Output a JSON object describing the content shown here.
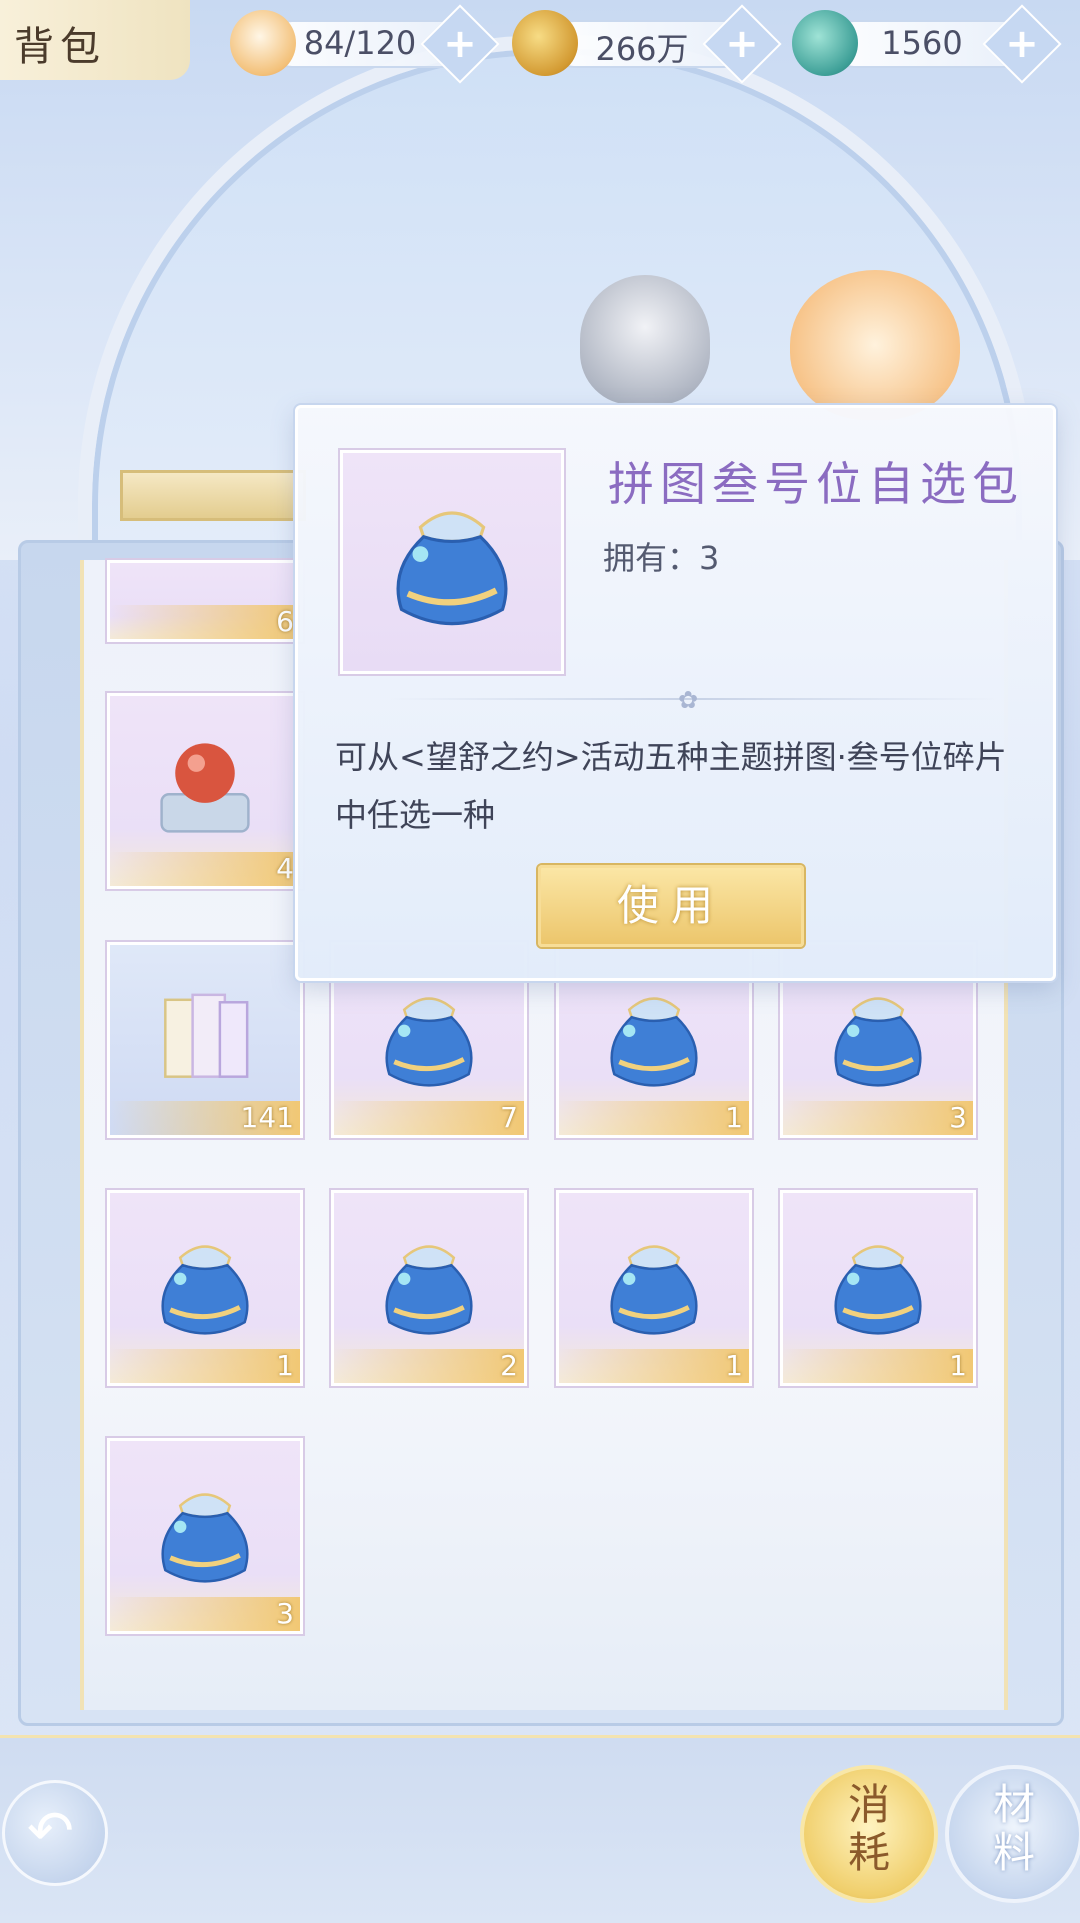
{
  "header": {
    "title": "背包",
    "resources": [
      {
        "icon": "cat-stamina-icon",
        "value": "84/120"
      },
      {
        "icon": "gold-coin-icon",
        "value": "266万"
      },
      {
        "icon": "jade-fish-icon",
        "value": "1560"
      }
    ]
  },
  "inventory": {
    "counts": [
      "6",
      "4",
      "141",
      "7",
      "1",
      "3",
      "1",
      "2",
      "1",
      "1",
      "3"
    ]
  },
  "popup": {
    "title": "拼图叁号位自选包",
    "owned": "拥有：3",
    "description": "可从<望舒之约>活动五种主题拼图·叁号位碎片中任选一种",
    "use_label": "使用"
  },
  "tabs": {
    "consume": "消耗",
    "material": "材料"
  },
  "colors": {
    "accent_gold": "#ecc66c",
    "title_purple": "#8b6cc1",
    "panel_blue": "#d7e3f4"
  }
}
